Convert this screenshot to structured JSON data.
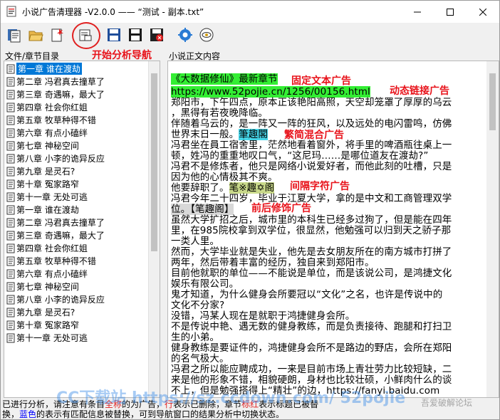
{
  "window": {
    "title": "小说广告清理器  -V2.0.0 —— “测试 - 副本.txt”"
  },
  "toolbar": {
    "buttons": [
      {
        "name": "new-file",
        "icon": "document-icon"
      },
      {
        "name": "open-folder",
        "icon": "folder-open-icon"
      },
      {
        "name": "new-item",
        "icon": "new-document-icon"
      },
      {
        "name": "start-analysis",
        "icon": "analyze-icon"
      },
      {
        "name": "save",
        "icon": "save-icon"
      },
      {
        "name": "save-as",
        "icon": "save-as-icon"
      },
      {
        "name": "save-close",
        "icon": "save-close-icon"
      },
      {
        "name": "settings",
        "icon": "gear-icon"
      },
      {
        "name": "about",
        "icon": "eye-icon"
      }
    ]
  },
  "annotations": {
    "start_nav": "开始分析导航",
    "fixed_ad": "固定文本广告",
    "dynamic_link": "动态链接广告",
    "simp_trad": "繁简混合广告",
    "separator": "间隔字符广告",
    "prefix_suffix": "前后修饰广告"
  },
  "left_pane": {
    "label": "文件/章节目录",
    "items": [
      "第一章 谁在渡劫",
      "第二章 冯君真去撞草了",
      "第三章 奇遇嘛，最大了",
      "第四章 社会你红姐",
      "第五章 牧草种得不错",
      "第六章 有点小磕绊",
      "第七章 神秘空间",
      "第八章 小李的诡异反应",
      "第九章 是灵石?",
      "第十章 冤家路窄",
      "第十一章 无处可逃",
      "第一章 谁在渡劫",
      "第二章 冯君真去撞草了",
      "第三章 奇遇嘛，最大了",
      "第四章 社会你红姐",
      "第五章 牧草种得不错",
      "第六章 有点小磕绊",
      "第七章 神秘空间",
      "第八章 小李的诡异反应",
      "第九章 是灵石?",
      "第十章 冤家路窄",
      "第十一章 无处可逃"
    ]
  },
  "right_pane": {
    "label": "小说正文内容",
    "line1": "《大数据修仙》最新章节",
    "line2": "https://www.52pojie.cn/1256/00156.html",
    "line3": "郑阳市，下午四点，原本正该艳阳高照，天空却笼罩了厚厚的乌云",
    "line4": "，黑得有若夜晚降临。",
    "line5": "伴随着乌云的，是一阵又一阵的狂风，以及远处的电闪雷鸣，仿佛",
    "line6a": "世界末日一般。",
    "line6b": "筆趣閣",
    "line7": "冯君坐在員工宿舍里，茫然地看着窗外，将手里的啤酒瓶往桌上一",
    "line8": "顿，姓冯的重重地叹口气，“这尼玛……是哪位道友在渡劫?”",
    "line9": "冯君不是修炼者，他只是网络小说爱好者，而他此刻的吐槽，只是",
    "line10": "因为他的心情极其不爽。",
    "line11a": "他要辞职了。",
    "line11b": "笔※趣✡阁",
    "line12": "冯君今年二十四岁，毕业于江夏大学，拿的是中文和工商管理双学",
    "line13": "位。【笔趣阁】",
    "line14": "虽然大学扩招之后，城市里的本科生已经多过狗了，但是能在四年",
    "line15": "里，在985院校拿到双学位，很显然，他勉强可以归到天之骄子那",
    "line16": "一类人里。",
    "line17": "然而，大学毕业就是失业，他先是去女朋友所在的南方城市打拼了",
    "line18": "两年，然后带着丰富的经历，独自来到郑阳市。",
    "line19": "目前他就职的单位——不能说是单位，而是该说公司，是鸿捷文化",
    "line20": "娱乐有限公司。",
    "line21": "鬼才知道，为什么健身会所要冠以“文化”之名，也许是传说中的",
    "line22": "文化不分家?",
    "line23": "没错，冯某人现在是就职于鸿捷健身会所。",
    "line24": "不是传说中艳、遇无数的健身教练，而是负责接待、跑腿和打扫卫",
    "line25": "生的小弟。",
    "line26": "健身教练是要证件的，鸿捷健身会所不是路边的野店，会所在郑阳",
    "line27": "的名气极大。",
    "line28": "冯君之所以能应聘成功，一来是目前市场上青壮劳力比较短缺，二",
    "line29": "来是他的形象不错，相貌硬朗，身材也比较壮硕，小鲜肉什么的谈",
    "line30": "不上，但是勉强搭得上“精壮”的边，https://fanyi.baidu.com"
  },
  "status": {
    "line1_a": "已进行分析，请注意有条目",
    "line1_b": "全称",
    "line1_c": "的为广告，",
    "line1_d": "行",
    "line1_e": "表示已删除，章节",
    "line1_f": "标红",
    "line1_g": "表示标题已被替",
    "line2_a": "换，",
    "line2_b": "蓝色",
    "line2_c": "的表示有匹配信息被替换，可到导航窗口的结果分析中切换状态。"
  },
  "watermark": {
    "text": "CC下载站 https://sz.ccdown.com/ 52pojie",
    "corner": "吾爱破解论坛"
  }
}
